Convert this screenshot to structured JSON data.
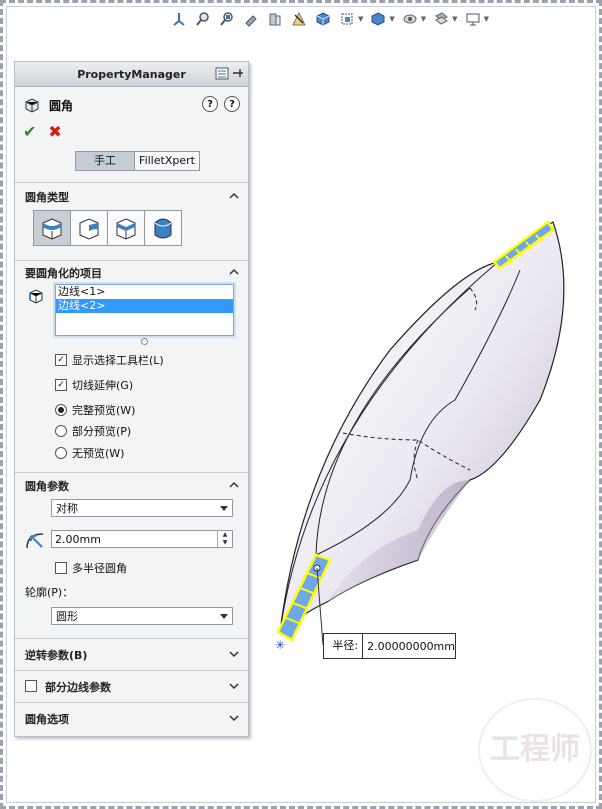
{
  "property_manager": {
    "title": "PropertyManager",
    "feature_name": "圆角",
    "tabs": {
      "manual": "手工",
      "filletxpert": "FilletXpert"
    },
    "fillet_type": {
      "title": "圆角类型"
    },
    "items": {
      "title": "要圆角化的项目",
      "list": [
        "边线<1>",
        "边线<2>"
      ],
      "show_toolbar": "显示选择工具栏(L)",
      "tangent_propagation": "切线延伸(G)",
      "preview_full": "完整预览(W)",
      "preview_partial": "部分预览(P)",
      "preview_none": "无预览(W)"
    },
    "params": {
      "title": "圆角参数",
      "method": "对称",
      "radius": "2.00mm",
      "multi_radius": "多半径圆角",
      "profile_label": "轮廓(P)：",
      "profile": "圆形"
    },
    "setback": {
      "title": "逆转参数(B)"
    },
    "partial_edge": {
      "title": "部分边线参数"
    },
    "fillet_options": {
      "title": "圆角选项"
    }
  },
  "viewport": {
    "radius_label": "半径:",
    "radius_value": "2.00000000mm"
  },
  "watermark": "工程师",
  "colors": {
    "selected_edge": "#ffff00",
    "selection_highlight": "#3399ff",
    "ok": "#2e8b1f",
    "cancel": "#d11a1a"
  }
}
